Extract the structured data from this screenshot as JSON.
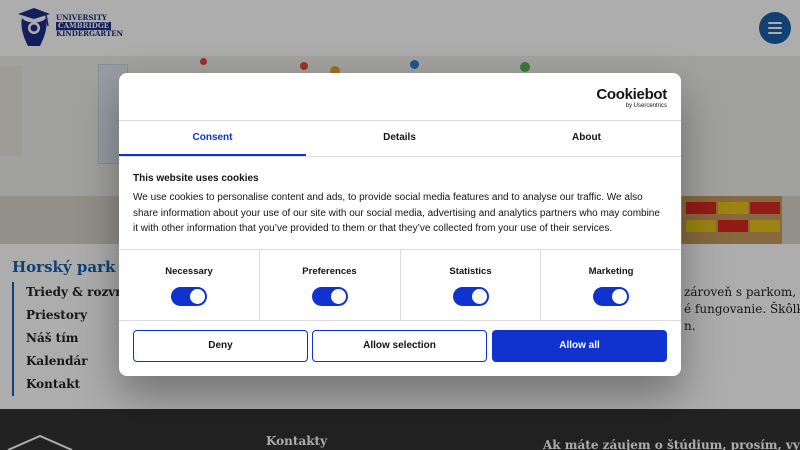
{
  "logo": {
    "line1": "UNIVERSITY",
    "line2": "CAMBRIDGE",
    "line3": "KINDERGARTEN"
  },
  "subnav": {
    "title": "Horský park",
    "items": [
      "Triedy & rozvrhy",
      "Priestory",
      "Náš tím",
      "Kalendár",
      "Kontakt"
    ]
  },
  "side_text": {
    "line1": "zároveň s parkom,",
    "line2": "é fungovanie. Škôlka",
    "line3": "n."
  },
  "footer": {
    "title": "Kontakty",
    "text": "Ak máte záujem o štúdium, prosím, vyplňte"
  },
  "cookie_dialog": {
    "brand": "Cookiebot",
    "brand_sub": "by Usercentrics",
    "tabs": [
      "Consent",
      "Details",
      "About"
    ],
    "active_tab": "Consent",
    "heading": "This website uses cookies",
    "body": "We use cookies to personalise content and ads, to provide social media features and to analyse our traffic. We also share information about your use of our site with our social media, advertising and analytics partners who may combine it with other information that you’ve provided to them or that they’ve collected from your use of their services.",
    "toggles": [
      {
        "label": "Necessary",
        "on": true
      },
      {
        "label": "Preferences",
        "on": true
      },
      {
        "label": "Statistics",
        "on": true
      },
      {
        "label": "Marketing",
        "on": true
      }
    ],
    "buttons": {
      "deny": "Deny",
      "allow_selection": "Allow selection",
      "allow_all": "Allow all"
    }
  },
  "colors": {
    "accent": "#1032cf",
    "brand_blue": "#1a5fa8",
    "footer_bg": "#333333"
  },
  "icons": {
    "menu": "hamburger-menu-icon",
    "logo": "lion-crest-icon"
  }
}
